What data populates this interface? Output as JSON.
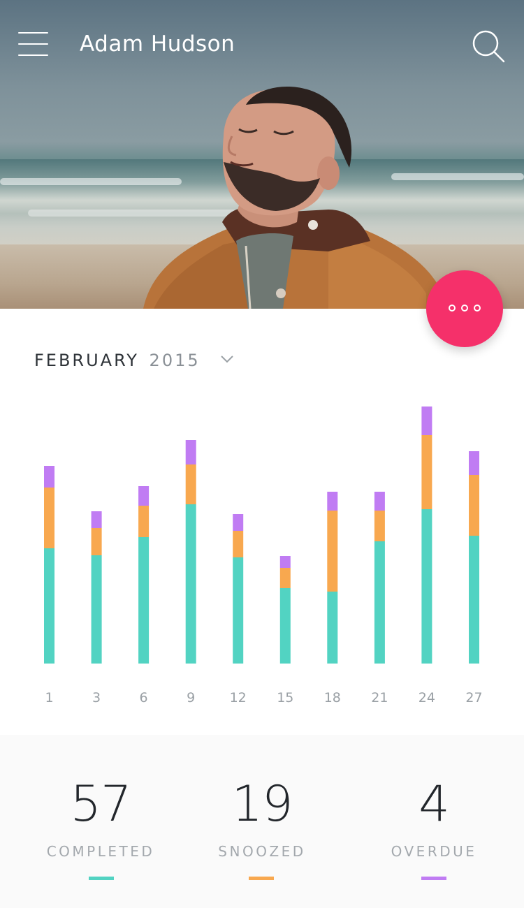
{
  "header": {
    "user_name": "Adam Hudson",
    "menu_icon": "hamburger-menu-icon",
    "search_icon": "search-icon"
  },
  "fab": {
    "icon": "more-horizontal-icon",
    "color": "#f5306a"
  },
  "period": {
    "month": "FEBRUARY",
    "year": "2015",
    "icon": "chevron-down-icon"
  },
  "colors": {
    "completed": "#52d3c2",
    "snoozed": "#f8a84f",
    "overdue": "#c07cf3"
  },
  "chart_data": {
    "type": "bar",
    "stacked": true,
    "categories": [
      "1",
      "3",
      "6",
      "9",
      "12",
      "15",
      "18",
      "21",
      "24",
      "27"
    ],
    "series": [
      {
        "name": "COMPLETED",
        "values": [
          165,
          155,
          181,
          228,
          152,
          108,
          103,
          175,
          221,
          183
        ]
      },
      {
        "name": "SNOOZED",
        "values": [
          87,
          39,
          45,
          57,
          38,
          29,
          116,
          44,
          106,
          87
        ]
      },
      {
        "name": "OVERDUE",
        "values": [
          31,
          24,
          28,
          35,
          24,
          17,
          27,
          27,
          41,
          34
        ]
      }
    ],
    "ylim": [
      0,
      370
    ],
    "grid": false,
    "legend": "none"
  },
  "stats": [
    {
      "value": "57",
      "label": "COMPLETED",
      "color": "#52d3c2"
    },
    {
      "value": "19",
      "label": "SNOOZED",
      "color": "#f8a84f"
    },
    {
      "value": "4",
      "label": "OVERDUE",
      "color": "#c07cf3"
    }
  ]
}
